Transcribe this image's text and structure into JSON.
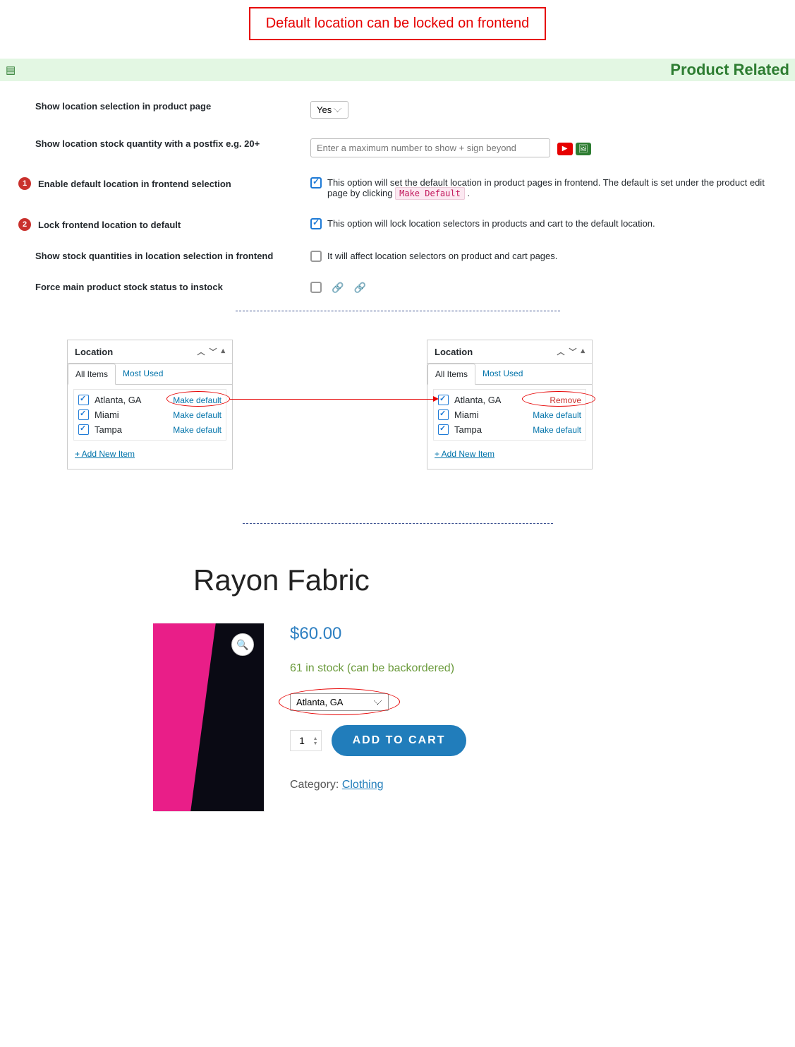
{
  "annotation_top": "Default location can be locked on frontend",
  "section_title": "Product Related",
  "settings": {
    "r1_label": "Show location selection in product page",
    "r1_value": "Yes",
    "r2_label": "Show location stock quantity with a postfix e.g. 20+",
    "r2_placeholder": "Enter a maximum number to show + sign beyond",
    "r3_badge": "1",
    "r3_label": "Enable default location in frontend selection",
    "r3_desc_a": "This option will set the default location in product pages in frontend. The default is set under the product edit page by clicking ",
    "r3_code": "Make Default",
    "r3_desc_b": " .",
    "r4_badge": "2",
    "r4_label": "Lock frontend location to default",
    "r4_desc": "This option will lock location selectors in products and cart to the default location.",
    "r5_label": "Show stock quantities in location selection in frontend",
    "r5_desc": "It will affect location selectors on product and cart pages.",
    "r6_label": "Force main product stock status to instock"
  },
  "panel_header": "Location",
  "panel_tab_all": "All Items",
  "panel_tab_most": "Most Used",
  "panel_add": "+ Add New Item",
  "make_default": "Make default",
  "remove": "Remove",
  "locations": {
    "l1": "Atlanta, GA",
    "l2": "Miami",
    "l3": "Tampa"
  },
  "product": {
    "title": "Rayon Fabric",
    "price": "$60.00",
    "stock_msg": "61 in stock (can be backordered)",
    "loc_selected": "Atlanta, GA",
    "qty": "1",
    "add_btn": "ADD TO CART",
    "cat_label": "Category: ",
    "cat_link": "Clothing"
  }
}
